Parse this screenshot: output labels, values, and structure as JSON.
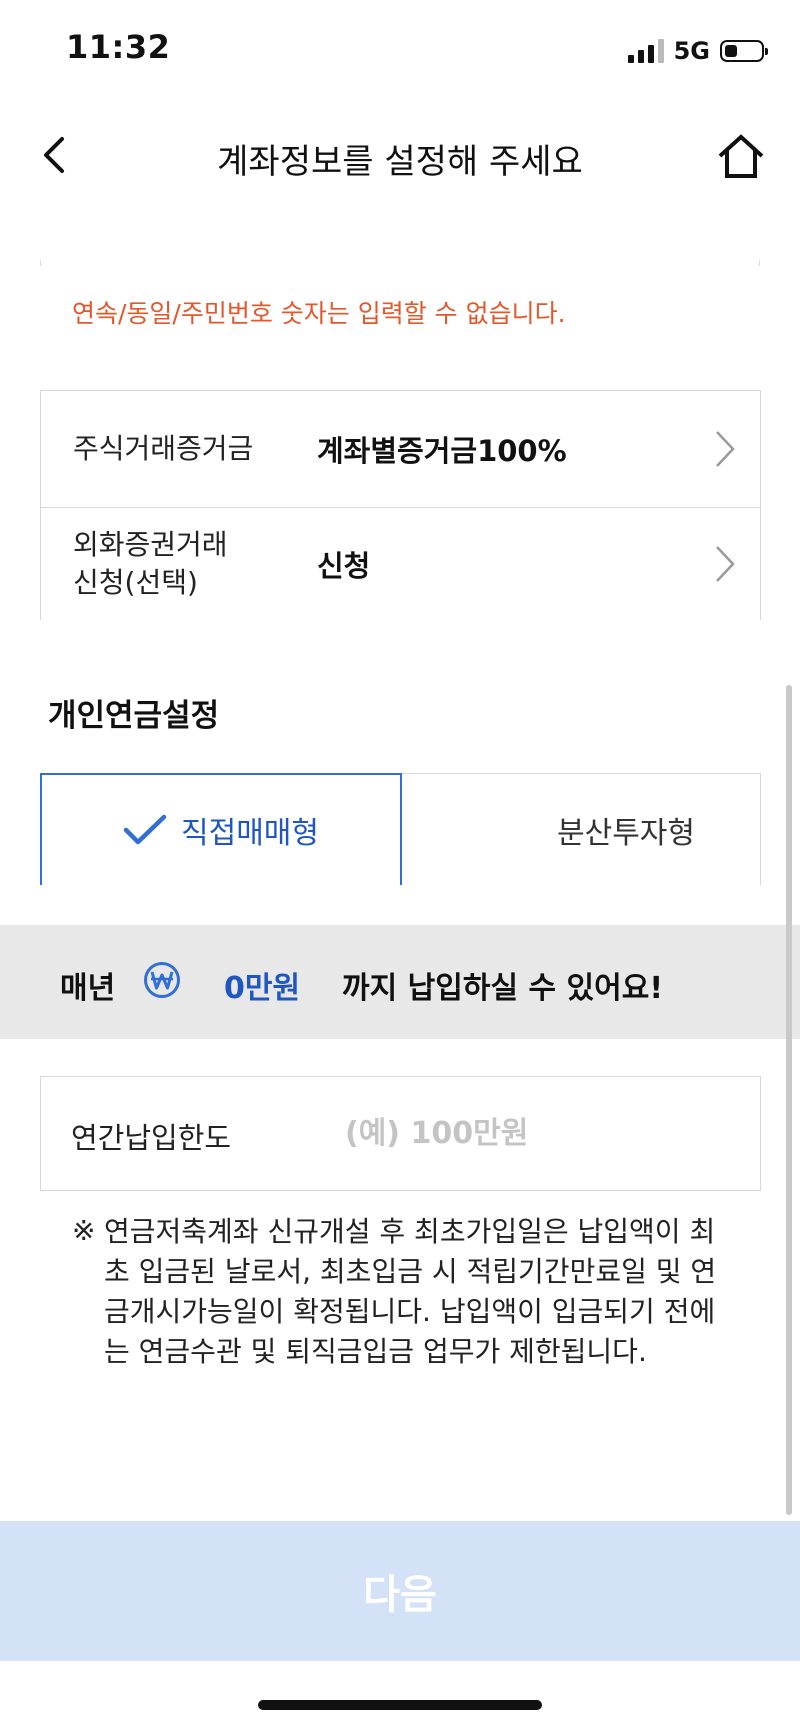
{
  "status_bar": {
    "time": "11:32",
    "network": "5G"
  },
  "header": {
    "title": "계좌정보를 설정해 주세요"
  },
  "warning_text": "연속/동일/주민번호 숫자는 입력할 수 없습니다.",
  "settings": [
    {
      "label_lines": [
        "주식거래증거금"
      ],
      "value": "계좌별증거금100%"
    },
    {
      "label_lines": [
        "외화증권거래",
        "신청(선택)"
      ],
      "value": "신청"
    }
  ],
  "pension": {
    "section_title": "개인연금설정",
    "tabs": [
      {
        "label": "직접매매형",
        "selected": true
      },
      {
        "label": "분산투자형",
        "selected": false
      }
    ]
  },
  "limit_banner": {
    "prefix": "매년",
    "amount": "0만원",
    "suffix": "까지 납입하실 수 있어요!"
  },
  "annual_limit": {
    "label": "연간납입한도",
    "value": "",
    "placeholder": "(예) 100만원"
  },
  "notice": {
    "mark": "※",
    "text": "연금저축계좌 신규개설 후 최초가입일은 납입액이 최초 입금된 날로서, 최초입금 시 적립기간만료일 및 연금개시가능일이 확정됩니다. 납입액이 입금되기 전에는 연금수관 및 퇴직금입금 업무가 제한됩니다."
  },
  "next_button": {
    "label": "다음"
  },
  "colors": {
    "accent": "#1f56c3",
    "warning": "#e2572b",
    "button_disabled": "#d3e2f6",
    "band": "#e8e8e8"
  }
}
